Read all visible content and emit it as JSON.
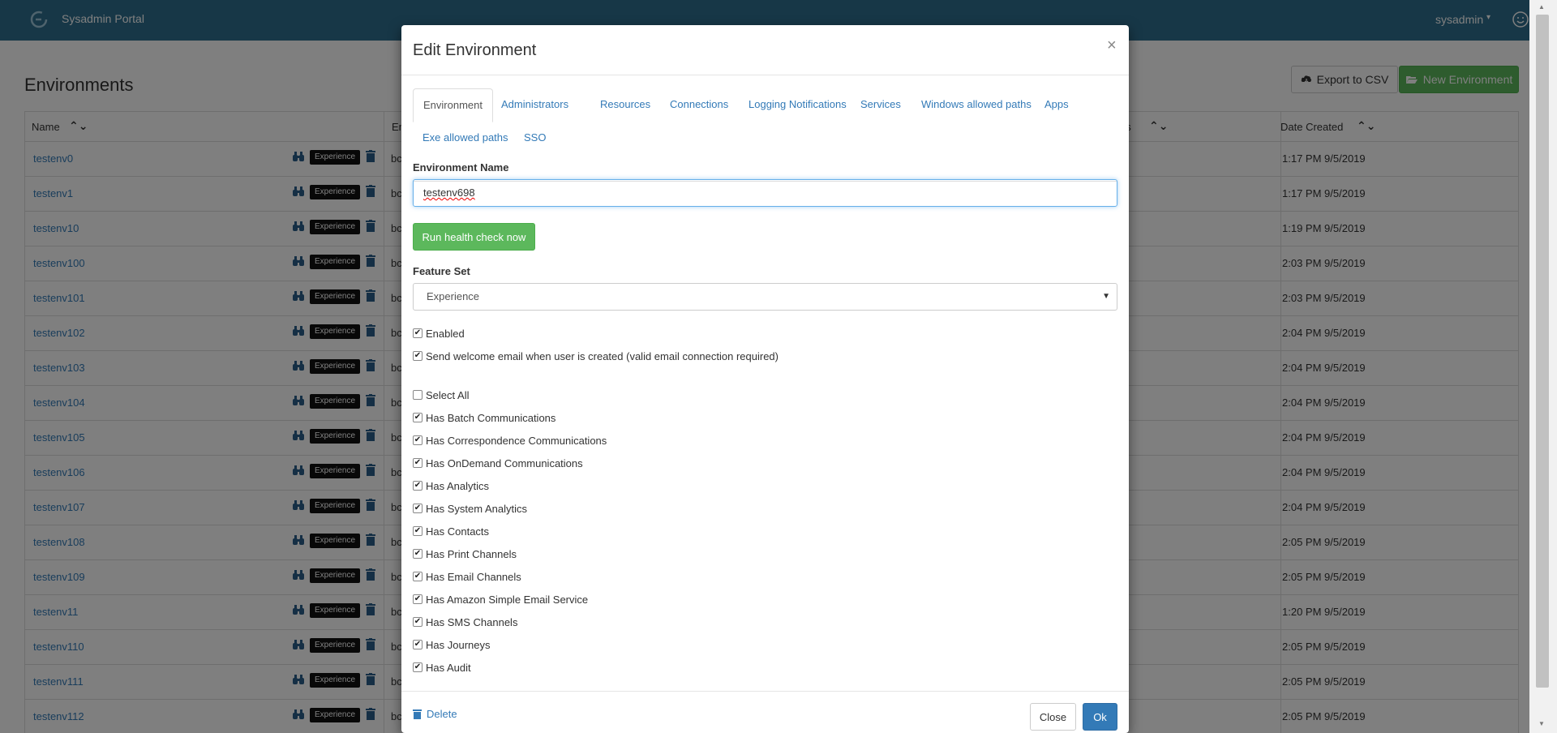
{
  "app": {
    "brand": "Sysadmin Portal",
    "user": "sysadmin"
  },
  "page": {
    "title": "Environments",
    "export_label": "Export to CSV",
    "new_label": "New Environment",
    "columns": {
      "name": "Name",
      "env": "En",
      "tail": "es",
      "date": "Date Created"
    },
    "rows": [
      {
        "name": "testenv0",
        "badge": "Experience",
        "bc": "bc",
        "date": "1:17 PM 9/5/2019"
      },
      {
        "name": "testenv1",
        "badge": "Experience",
        "bc": "bc",
        "date": "1:17 PM 9/5/2019"
      },
      {
        "name": "testenv10",
        "badge": "Experience",
        "bc": "bc",
        "date": "1:19 PM 9/5/2019"
      },
      {
        "name": "testenv100",
        "badge": "Experience",
        "bc": "bc",
        "date": "2:03 PM 9/5/2019"
      },
      {
        "name": "testenv101",
        "badge": "Experience",
        "bc": "bc",
        "date": "2:03 PM 9/5/2019"
      },
      {
        "name": "testenv102",
        "badge": "Experience",
        "bc": "bc",
        "date": "2:04 PM 9/5/2019"
      },
      {
        "name": "testenv103",
        "badge": "Experience",
        "bc": "bc",
        "date": "2:04 PM 9/5/2019"
      },
      {
        "name": "testenv104",
        "badge": "Experience",
        "bc": "bc",
        "date": "2:04 PM 9/5/2019"
      },
      {
        "name": "testenv105",
        "badge": "Experience",
        "bc": "bc",
        "date": "2:04 PM 9/5/2019"
      },
      {
        "name": "testenv106",
        "badge": "Experience",
        "bc": "bc",
        "date": "2:04 PM 9/5/2019"
      },
      {
        "name": "testenv107",
        "badge": "Experience",
        "bc": "bc",
        "date": "2:04 PM 9/5/2019"
      },
      {
        "name": "testenv108",
        "badge": "Experience",
        "bc": "bc",
        "date": "2:05 PM 9/5/2019"
      },
      {
        "name": "testenv109",
        "badge": "Experience",
        "bc": "bc",
        "date": "2:05 PM 9/5/2019"
      },
      {
        "name": "testenv11",
        "badge": "Experience",
        "bc": "bc",
        "date": "1:20 PM 9/5/2019"
      },
      {
        "name": "testenv110",
        "badge": "Experience",
        "bc": "bc",
        "date": "2:05 PM 9/5/2019"
      },
      {
        "name": "testenv111",
        "badge": "Experience",
        "bc": "bc",
        "date": "2:05 PM 9/5/2019"
      },
      {
        "name": "testenv112",
        "badge": "Experience",
        "bc": "bc",
        "date": "2:05 PM 9/5/2019"
      }
    ]
  },
  "modal": {
    "title": "Edit Environment",
    "close_glyph": "×",
    "tabs": [
      "Environment",
      "Administrators",
      "Resources",
      "Connections",
      "Logging Notifications",
      "Services",
      "Windows allowed paths",
      "Apps",
      "Exe allowed paths",
      "SSO"
    ],
    "env_name_label": "Environment Name",
    "env_name_value": "testenv698",
    "health_label": "Run health check now",
    "feature_set_label": "Feature Set",
    "feature_set_value": "Experience",
    "enabled_label": "Enabled",
    "welcome_label": "Send welcome email when user is created (valid email connection required)",
    "select_all_label": "Select All",
    "features": [
      "Has Batch Communications",
      "Has Correspondence Communications",
      "Has OnDemand Communications",
      "Has Analytics",
      "Has System Analytics",
      "Has Contacts",
      "Has Print Channels",
      "Has Email Channels",
      "Has Amazon Simple Email Service",
      "Has SMS Channels",
      "Has Journeys",
      "Has Audit"
    ],
    "delete_label": "Delete",
    "close_label": "Close",
    "ok_label": "Ok"
  },
  "colors": {
    "navbar": "#2e6f8e",
    "success": "#5cb85c",
    "primary": "#337ab7"
  }
}
